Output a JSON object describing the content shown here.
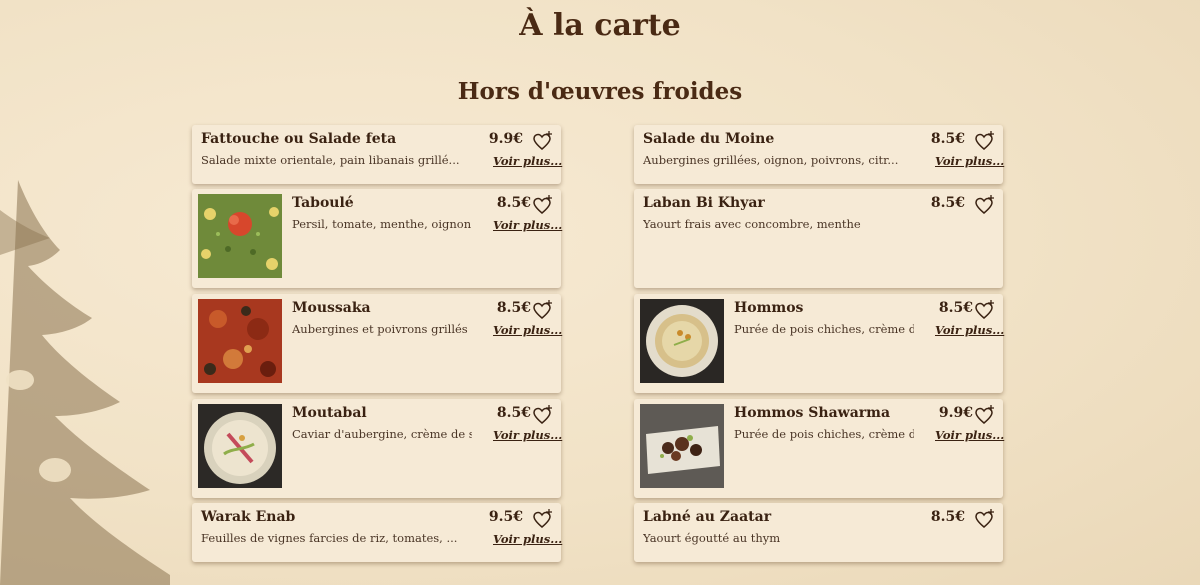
{
  "page": {
    "title": "À la carte",
    "section": "Hors d'œuvres froides",
    "more_label": "Voir plus..."
  },
  "left": [
    {
      "name": "Fattouche ou Salade feta",
      "desc": "Salade mixte orientale, pain libanais grillé...",
      "price": "9.9€",
      "image": ""
    },
    {
      "name": "Taboulé",
      "desc": "Persil, tomate, menthe, oignon...",
      "price": "8.5€",
      "image": "tabouleh-photo"
    },
    {
      "name": "Moussaka",
      "desc": "Aubergines et poivrons grillés ...",
      "price": "8.5€",
      "image": "moussaka-photo"
    },
    {
      "name": "Moutabal",
      "desc": "Caviar d'aubergine, crème de s...",
      "price": "8.5€",
      "image": "moutabal-photo"
    },
    {
      "name": "Warak Enab",
      "desc": "Feuilles de vignes farcies de riz, tomates, ...",
      "price": "9.5€",
      "image": ""
    }
  ],
  "right": [
    {
      "name": "Salade du Moine",
      "desc": "Aubergines grillées, oignon, poivrons, citr...",
      "price": "8.5€",
      "image": ""
    },
    {
      "name": "Laban Bi Khyar",
      "desc": "Yaourt frais avec concombre, menthe",
      "price": "8.5€",
      "image": ""
    },
    {
      "name": "Hommos",
      "desc": "Purée de pois chiches, crème d...",
      "price": "8.5€",
      "image": "hommos-photo"
    },
    {
      "name": "Hommos Shawarma",
      "desc": "Purée de pois chiches, crème d...",
      "price": "9.9€",
      "image": "hommos-shawarma-photo"
    },
    {
      "name": "Labné au Zaatar",
      "desc": "Yaourt égoutté au thym",
      "price": "8.5€",
      "image": ""
    }
  ]
}
